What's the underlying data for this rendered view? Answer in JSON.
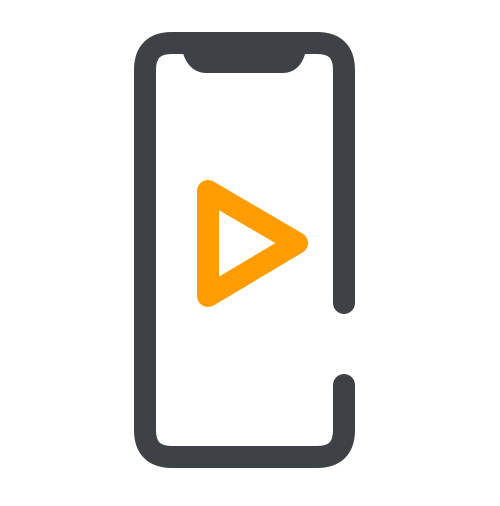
{
  "colors": {
    "background": "#ffffff",
    "phone_outline": "#3e4145",
    "play_accent": "#ff9d00"
  },
  "icons": {
    "phone": "smartphone-icon",
    "play": "play-icon"
  }
}
